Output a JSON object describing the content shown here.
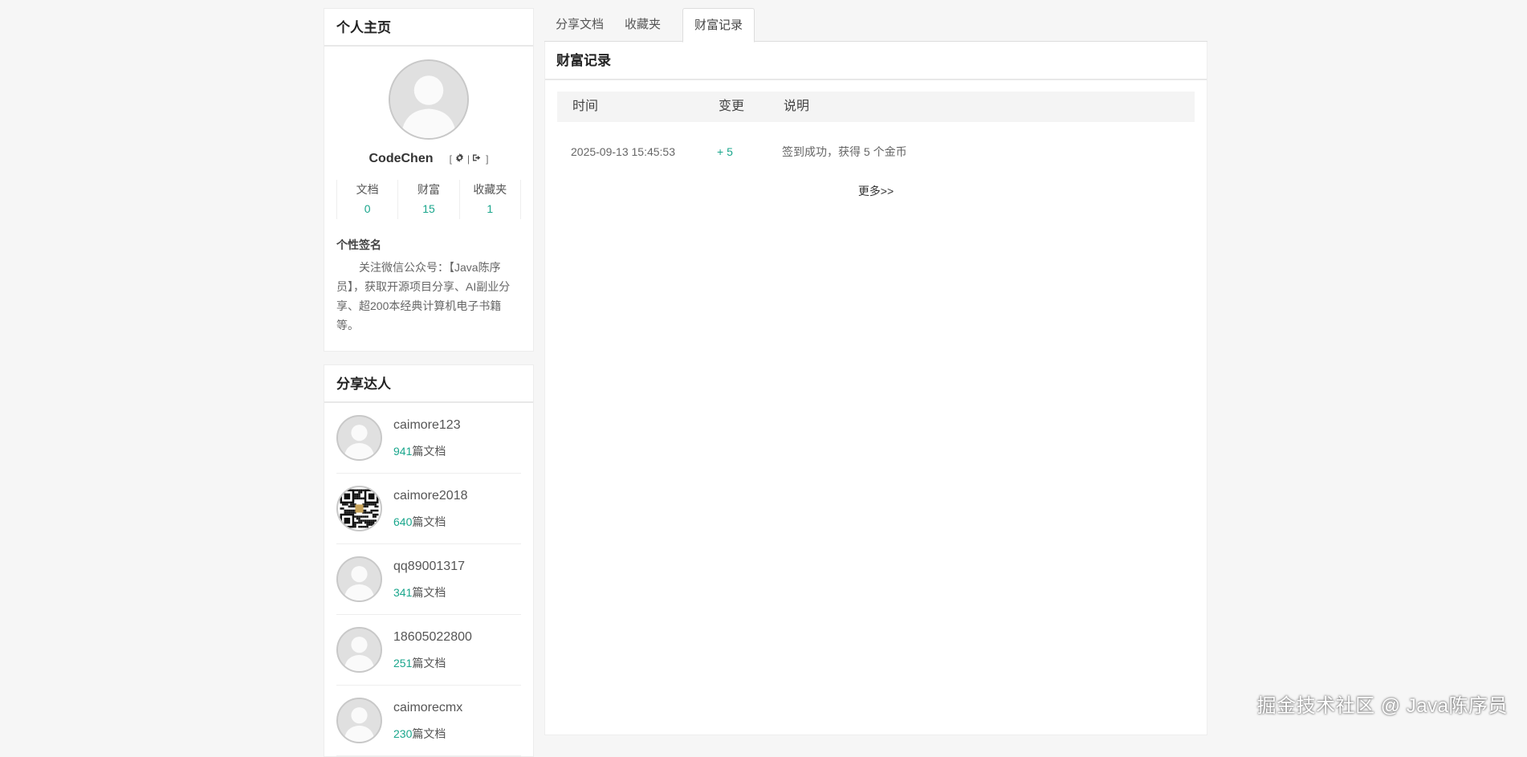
{
  "profile": {
    "panel_title": "个人主页",
    "username": "CodeChen",
    "settings_icon": "gear-icon",
    "logout_icon": "sign-out-icon",
    "stats": [
      {
        "label": "文档",
        "value": "0"
      },
      {
        "label": "财富",
        "value": "15"
      },
      {
        "label": "收藏夹",
        "value": "1"
      }
    ],
    "signature_title": "个性签名",
    "signature": "关注微信公众号：【Java陈序员】，获取开源项目分享、AI副业分享、超200本经典计算机电子书籍等。"
  },
  "sharers": {
    "panel_title": "分享达人",
    "unit": "篇文档",
    "items": [
      {
        "name": "caimore123",
        "count": "941",
        "avatar": "default"
      },
      {
        "name": "caimore2018",
        "count": "640",
        "avatar": "qr"
      },
      {
        "name": "qq89001317",
        "count": "341",
        "avatar": "default"
      },
      {
        "name": "18605022800",
        "count": "251",
        "avatar": "default"
      },
      {
        "name": "caimorecmx",
        "count": "230",
        "avatar": "default"
      }
    ]
  },
  "tabs": [
    {
      "label": "分享文档",
      "active": false
    },
    {
      "label": "收藏夹",
      "active": false
    },
    {
      "label": "财富记录",
      "active": true
    }
  ],
  "records": {
    "title": "财富记录",
    "columns": [
      "时间",
      "变更",
      "说明"
    ],
    "rows": [
      {
        "time": "2025-09-13 15:45:53",
        "delta": "+ 5",
        "desc": "签到成功，获得 5 个金币"
      }
    ],
    "more": "更多>>"
  },
  "watermark": "掘金技术社区 @ Java陈序员",
  "colors": {
    "accent": "#1aa68c",
    "background": "#f6f6f6"
  }
}
